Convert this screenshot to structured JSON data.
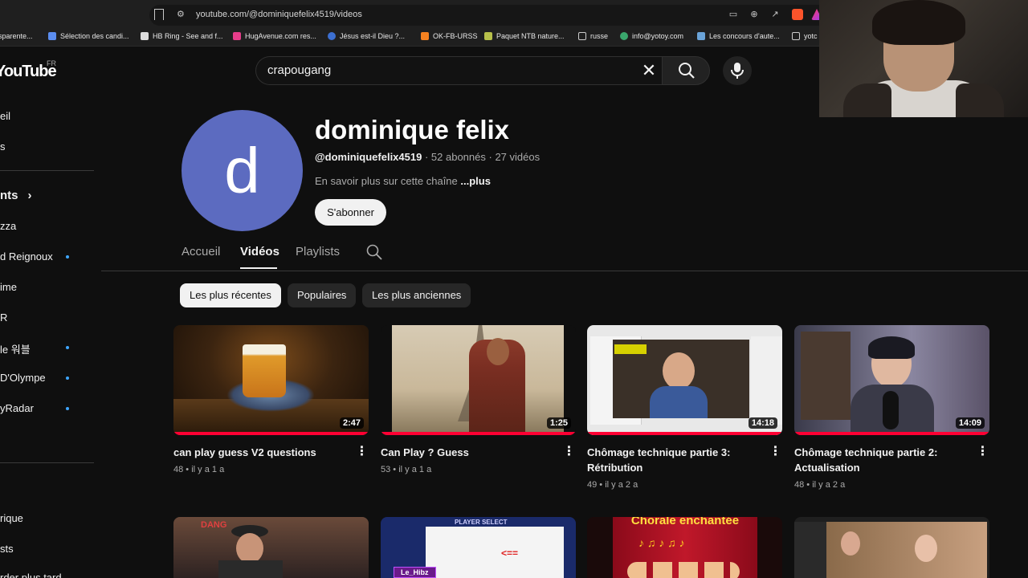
{
  "browser": {
    "url": "youtube.com/@dominiquefelix4519/videos",
    "bookmarks": [
      "sparente...",
      "Sélection des candi...",
      "HB Ring - See and f...",
      "HugAvenue.com res...",
      "Jésus est-il Dieu ?...",
      "OK-FB-URSS",
      "Paquet NTB nature...",
      "russe",
      "info@yotoy.com",
      "Les concours d'aute...",
      "yotc"
    ]
  },
  "header": {
    "logo": "YouTube",
    "region": "FR",
    "search_value": "crapougang"
  },
  "sidebar": {
    "items": [
      "eil",
      "s",
      "nts",
      "zza",
      "d Reignoux",
      "ime",
      "R",
      "le 워블",
      "D'Olympe",
      "yRadar",
      "rique",
      "sts",
      "rder plus tard"
    ]
  },
  "channel": {
    "avatar_letter": "d",
    "avatar_color": "#5c6bc0",
    "name": "dominique felix",
    "handle": "@dominiquefelix4519",
    "subscribers": "52 abonnés",
    "video_count": "27 vidéos",
    "about": "En savoir plus sur cette chaîne",
    "about_more": "...plus",
    "subscribe_label": "S'abonner"
  },
  "tabs": [
    {
      "label": "Accueil"
    },
    {
      "label": "Vidéos"
    },
    {
      "label": "Playlists"
    }
  ],
  "chips": [
    "Les plus récentes",
    "Populaires",
    "Les plus anciennes"
  ],
  "videos": [
    {
      "title": "can play guess V2 questions",
      "views": "48",
      "age": "il y a 1 a",
      "duration": "2:47"
    },
    {
      "title": "Can Play ? Guess",
      "views": "53",
      "age": "il y a 1 a",
      "duration": "1:25"
    },
    {
      "title": "Chômage technique partie 3: Rétribution",
      "views": "49",
      "age": "il y a 2 a",
      "duration": "14:18"
    },
    {
      "title": "Chômage technique partie 2: Actualisation",
      "views": "48",
      "age": "il y a 2 a",
      "duration": "14:09"
    }
  ],
  "row2_text": {
    "player_select": "PLAYER SELECT",
    "le_hibz": "Le_Hibz",
    "chorale": "Chorale enchantée",
    "dang": "DANG"
  },
  "colors": {
    "accent_red": "#ff0033",
    "link_blue": "#3ea6ff"
  }
}
